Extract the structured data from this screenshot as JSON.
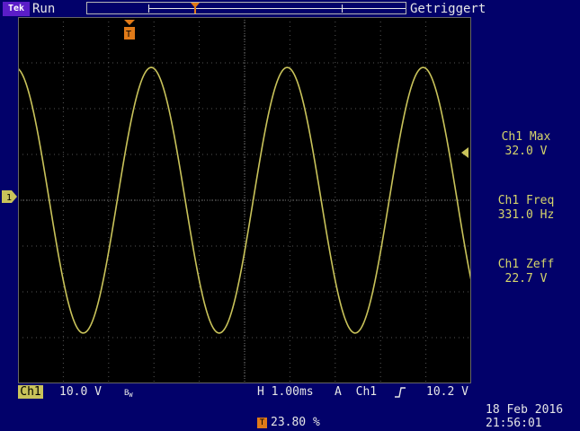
{
  "top_bar": {
    "brand": "Tek",
    "run_state": "Run",
    "trigger_status": "Getriggert"
  },
  "channel": {
    "marker_label": "1",
    "tag": "Ch1",
    "scale": "10.0 V",
    "bw_limit_glyph": "BW"
  },
  "trigger": {
    "marker_label": "T",
    "horizontal_scale": "H 1.00ms",
    "mode": "A",
    "source": "Ch1",
    "slope_glyph": "rising-edge",
    "level": "10.2 V",
    "position_pct": "23.80 %"
  },
  "measurements": [
    {
      "label": "Ch1 Max",
      "value": "32.0 V"
    },
    {
      "label": "Ch1 Freq",
      "value": "331.0 Hz"
    },
    {
      "label": "Ch1 Zeff",
      "value": "22.7 V"
    }
  ],
  "datetime": {
    "date": "18 Feb  2016",
    "time": "21:56:01"
  },
  "colors": {
    "background": "#02016a",
    "screen": "#000000",
    "trace": "#c9c35a",
    "trigger_orange": "#e07a18",
    "brand_purple": "#5b1dc8"
  },
  "chart_data": {
    "type": "line",
    "title": "",
    "xlabel": "",
    "ylabel": "",
    "series": [
      {
        "waveform": "sine",
        "period_divisions": 3.0,
        "amplitude_divisions": 2.9,
        "offset_divisions": 0.0
      }
    ],
    "grid": true,
    "divisions": {
      "x": 10,
      "y": 8
    }
  }
}
